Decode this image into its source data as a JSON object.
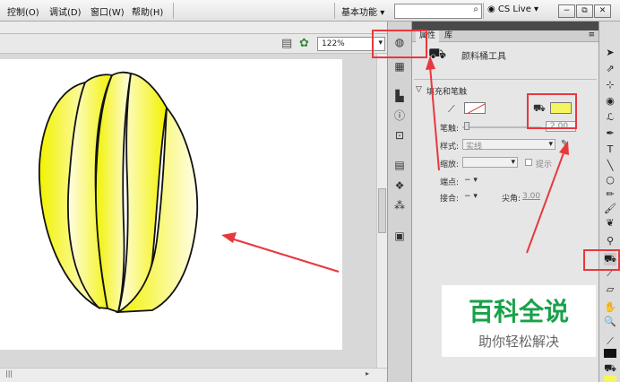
{
  "menus": [
    "控制(O)",
    "调试(D)",
    "窗口(W)",
    "帮助(H)"
  ],
  "workspace": {
    "label": "基本功能",
    "arrow": "▾"
  },
  "cs_live": "CS Live",
  "window_buttons": [
    "−",
    "⧉",
    "✕"
  ],
  "zoom": "122%",
  "tabs": {
    "properties": "属性",
    "library": "库"
  },
  "tool_name": "颜料桶工具",
  "section_title": "填充和笔触",
  "stroke_label": "笔触:",
  "stroke_value": "2.00",
  "style_label": "样式:",
  "style_value": "实线",
  "scale_label": "缩放:",
  "hint_label": "提示",
  "cap_label": "端点:",
  "join_label": "接合:",
  "miter_label": "尖角:",
  "miter_value": "3.00",
  "dash": "−",
  "colors": {
    "fill": "#f5f560",
    "stroke": "#e89aa0",
    "highlight": "#e8383d"
  },
  "watermark": {
    "title": "百科全说",
    "subtitle": "助你轻松解决",
    "title_color": "#1aa14a"
  },
  "icons": [
    "paint-bucket-icon",
    "selection-icon",
    "subselection-icon",
    "free-transform-icon",
    "3d-rotation-icon",
    "lasso-icon",
    "pen-icon",
    "text-icon",
    "line-icon",
    "oval-icon",
    "pencil-icon",
    "brush-icon",
    "deco-icon",
    "bone-icon",
    "ink-bottle-icon",
    "eyedropper-icon",
    "eraser-icon",
    "hand-icon",
    "zoom-icon"
  ]
}
